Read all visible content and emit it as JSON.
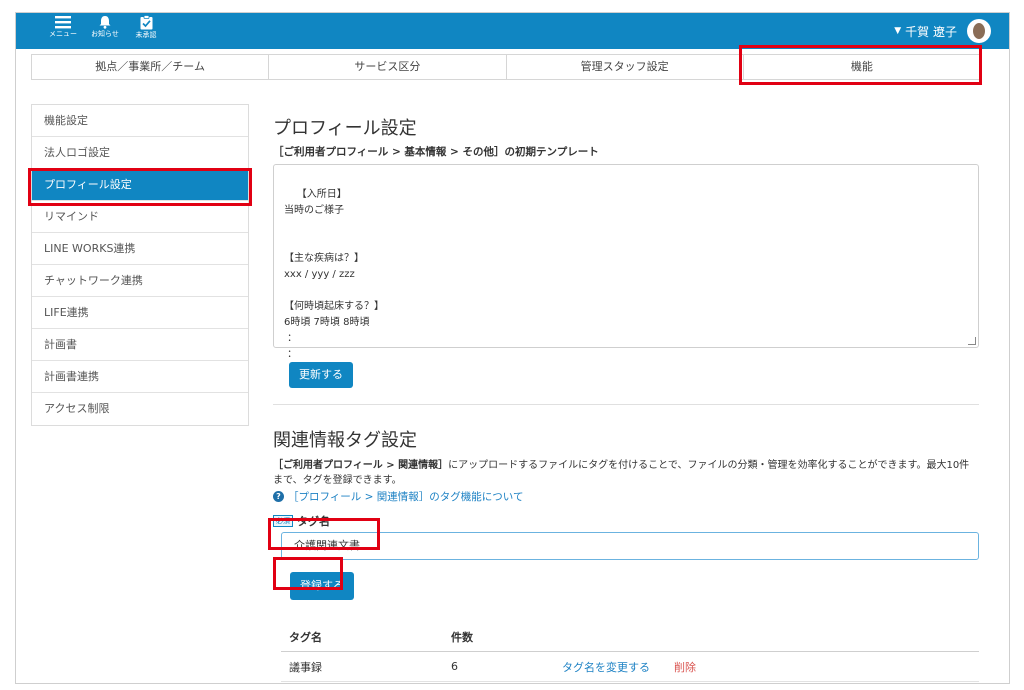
{
  "topbar": {
    "menu_label": "メニュー",
    "notice_label": "お知らせ",
    "unapproved_label": "未承認",
    "user_name": "千賀 遼子"
  },
  "tabs": [
    {
      "label": "拠点／事業所／チーム"
    },
    {
      "label": "サービス区分"
    },
    {
      "label": "管理スタッフ設定"
    },
    {
      "label": "機能"
    }
  ],
  "sidebar": {
    "items": [
      {
        "label": "機能設定"
      },
      {
        "label": "法人ロゴ設定"
      },
      {
        "label": "プロフィール設定",
        "active": true
      },
      {
        "label": "リマインド"
      },
      {
        "label": "LINE WORKS連携"
      },
      {
        "label": "チャットワーク連携"
      },
      {
        "label": "LIFE連携"
      },
      {
        "label": "計画書"
      },
      {
        "label": "計画書連携"
      },
      {
        "label": "アクセス制限"
      }
    ]
  },
  "profile": {
    "title": "プロフィール設定",
    "subtitle": "［ご利用者プロフィール > 基本情報 > その他］の初期テンプレート",
    "template_text": "【入所日】\n当時のご様子\n\n\n【主な疾病は？】\nxxx / yyy / zzz\n\n【何時頃起床する？】\n6時頃 7時頃 8時頃\n ：\n ：",
    "update_button": "更新する"
  },
  "tags": {
    "title": "関連情報タグ設定",
    "desc_bold": "［ご利用者プロフィール > 関連情報］",
    "desc_rest": "にアップロードするファイルにタグを付けることで、ファイルの分類・管理を効率化することができます。最大10件まで、タグを登録できます。",
    "help_icon_glyph": "?",
    "help_link": "［プロフィール > 関連情報］のタグ機能について",
    "required_badge": "必須",
    "field_label": "タグ名",
    "input_value": "介護関連文書",
    "register_button": "登録する",
    "table_headers": {
      "name": "タグ名",
      "count": "件数"
    },
    "rows": [
      {
        "name": "議事録",
        "count": "6",
        "rename": "タグ名を変更する",
        "delete": "削除"
      }
    ]
  },
  "colors": {
    "brand": "#1086c2",
    "highlight": "#e10013",
    "link": "#1e82c4",
    "danger": "#d9534f"
  }
}
